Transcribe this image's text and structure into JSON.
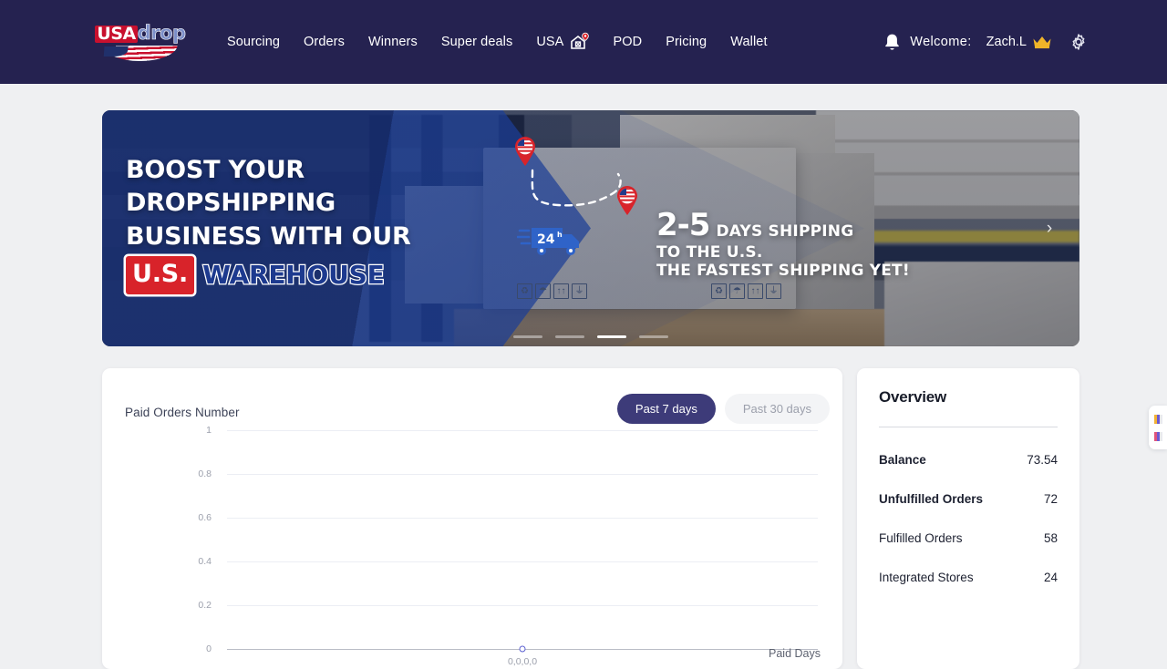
{
  "header": {
    "logo": {
      "usa": "USA",
      "drop": "drop",
      "icon": "usadrop-logo"
    },
    "nav": [
      {
        "label": "Sourcing",
        "icon": null
      },
      {
        "label": "Orders",
        "icon": null
      },
      {
        "label": "Winners",
        "icon": null
      },
      {
        "label": "Super deals",
        "icon": null
      },
      {
        "label": "USA",
        "icon": "warehouse-pin-icon"
      },
      {
        "label": "POD",
        "icon": null
      },
      {
        "label": "Pricing",
        "icon": null
      },
      {
        "label": "Wallet",
        "icon": null
      }
    ],
    "bell_icon": "bell-icon",
    "welcome_label": "Welcome:",
    "user_name": "Zach.L",
    "crown_icon": "crown-icon",
    "gear_icon": "gear-icon"
  },
  "banner": {
    "headline_lines": [
      "BOOST YOUR",
      "DROPSHIPPING",
      "BUSINESS WITH OUR"
    ],
    "highlight_us": "U.S.",
    "highlight_warehouse": "WAREHOUSE",
    "promo": {
      "big": "2-5",
      "small": "DAYS SHIPPING",
      "line2": "TO THE U.S.",
      "line3": "THE FASTEST SHIPPING YET!"
    },
    "truck_badge": "24",
    "truck_badge_sup": "h",
    "next_arrow": "›",
    "dots": [
      {
        "active": false
      },
      {
        "active": false
      },
      {
        "active": true
      },
      {
        "active": false
      }
    ]
  },
  "chart_card": {
    "title": "Paid Orders Number",
    "range_buttons": [
      {
        "label": "Past 7 days",
        "active": true
      },
      {
        "label": "Past 30 days",
        "active": false
      }
    ]
  },
  "chart_data": {
    "type": "line",
    "title": "Paid Orders Number",
    "xlabel": "Paid Days",
    "ylabel": "",
    "ylim": [
      0,
      1
    ],
    "ytick_labels": [
      "1",
      "0.8",
      "0.6",
      "0.4",
      "0.2",
      "0"
    ],
    "ytick_values": [
      1,
      0.8,
      0.6,
      0.4,
      0.2,
      0
    ],
    "grid": true,
    "legend": "none",
    "x": [
      "0,0,0,0"
    ],
    "xtick_labels": [
      "0,0,0,0"
    ],
    "series": [
      {
        "name": "Paid Orders Number",
        "values": [
          0
        ],
        "color": "#5a5fd1"
      }
    ]
  },
  "overview": {
    "title": "Overview",
    "rows": [
      {
        "label": "Balance",
        "value": "73.54",
        "bold": true
      },
      {
        "label": "Unfulfilled Orders",
        "value": "72",
        "bold": true
      },
      {
        "label": "Fulfilled Orders",
        "value": "58",
        "bold": false
      },
      {
        "label": "Integrated Stores",
        "value": "24",
        "bold": false
      }
    ]
  },
  "side_widget": {
    "name": "floating-help-widget"
  },
  "colors": {
    "header_bg": "#252250",
    "page_bg": "#eff0f2",
    "accent": "#3d3b79",
    "card_bg": "#ffffff",
    "flag_red": "#c8102e",
    "chart_point": "#5a5fd1",
    "crown_gold": "#f0b429"
  }
}
